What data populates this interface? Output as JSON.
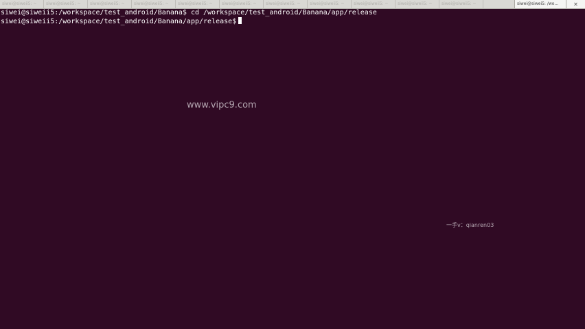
{
  "tabbar": {
    "inactive_tabs": [
      "siwei@siweii5: ~",
      "siwei@siweii5: ~",
      "siwei@siweii5: ~",
      "siwei@siweii5: ~",
      "siwei@siweii5: ~",
      "siwei@siweii5: ~",
      "siwei@siweii5: ~",
      "siwei@siweii5: ~",
      "siwei@siweii5: ~",
      "siwei@siweii5: ~",
      "siwei@siweii5: ~"
    ],
    "active_tab": "siwei@siwei5: /wo...",
    "close_glyph": "✕"
  },
  "terminal": {
    "lines": [
      "siwei@siweii5:/workspace/test_android/Banana$ cd /workspace/test_android/Banana/app/release",
      "siwei@siweii5:/workspace/test_android/Banana/app/release$"
    ]
  },
  "watermarks": {
    "site": "www.vipc9.com",
    "contact": "一手v：qianren03"
  },
  "colors": {
    "terminal_bg": "#300a24",
    "terminal_fg": "#ffffff",
    "tabbar_bg": "#d9d8d4"
  }
}
